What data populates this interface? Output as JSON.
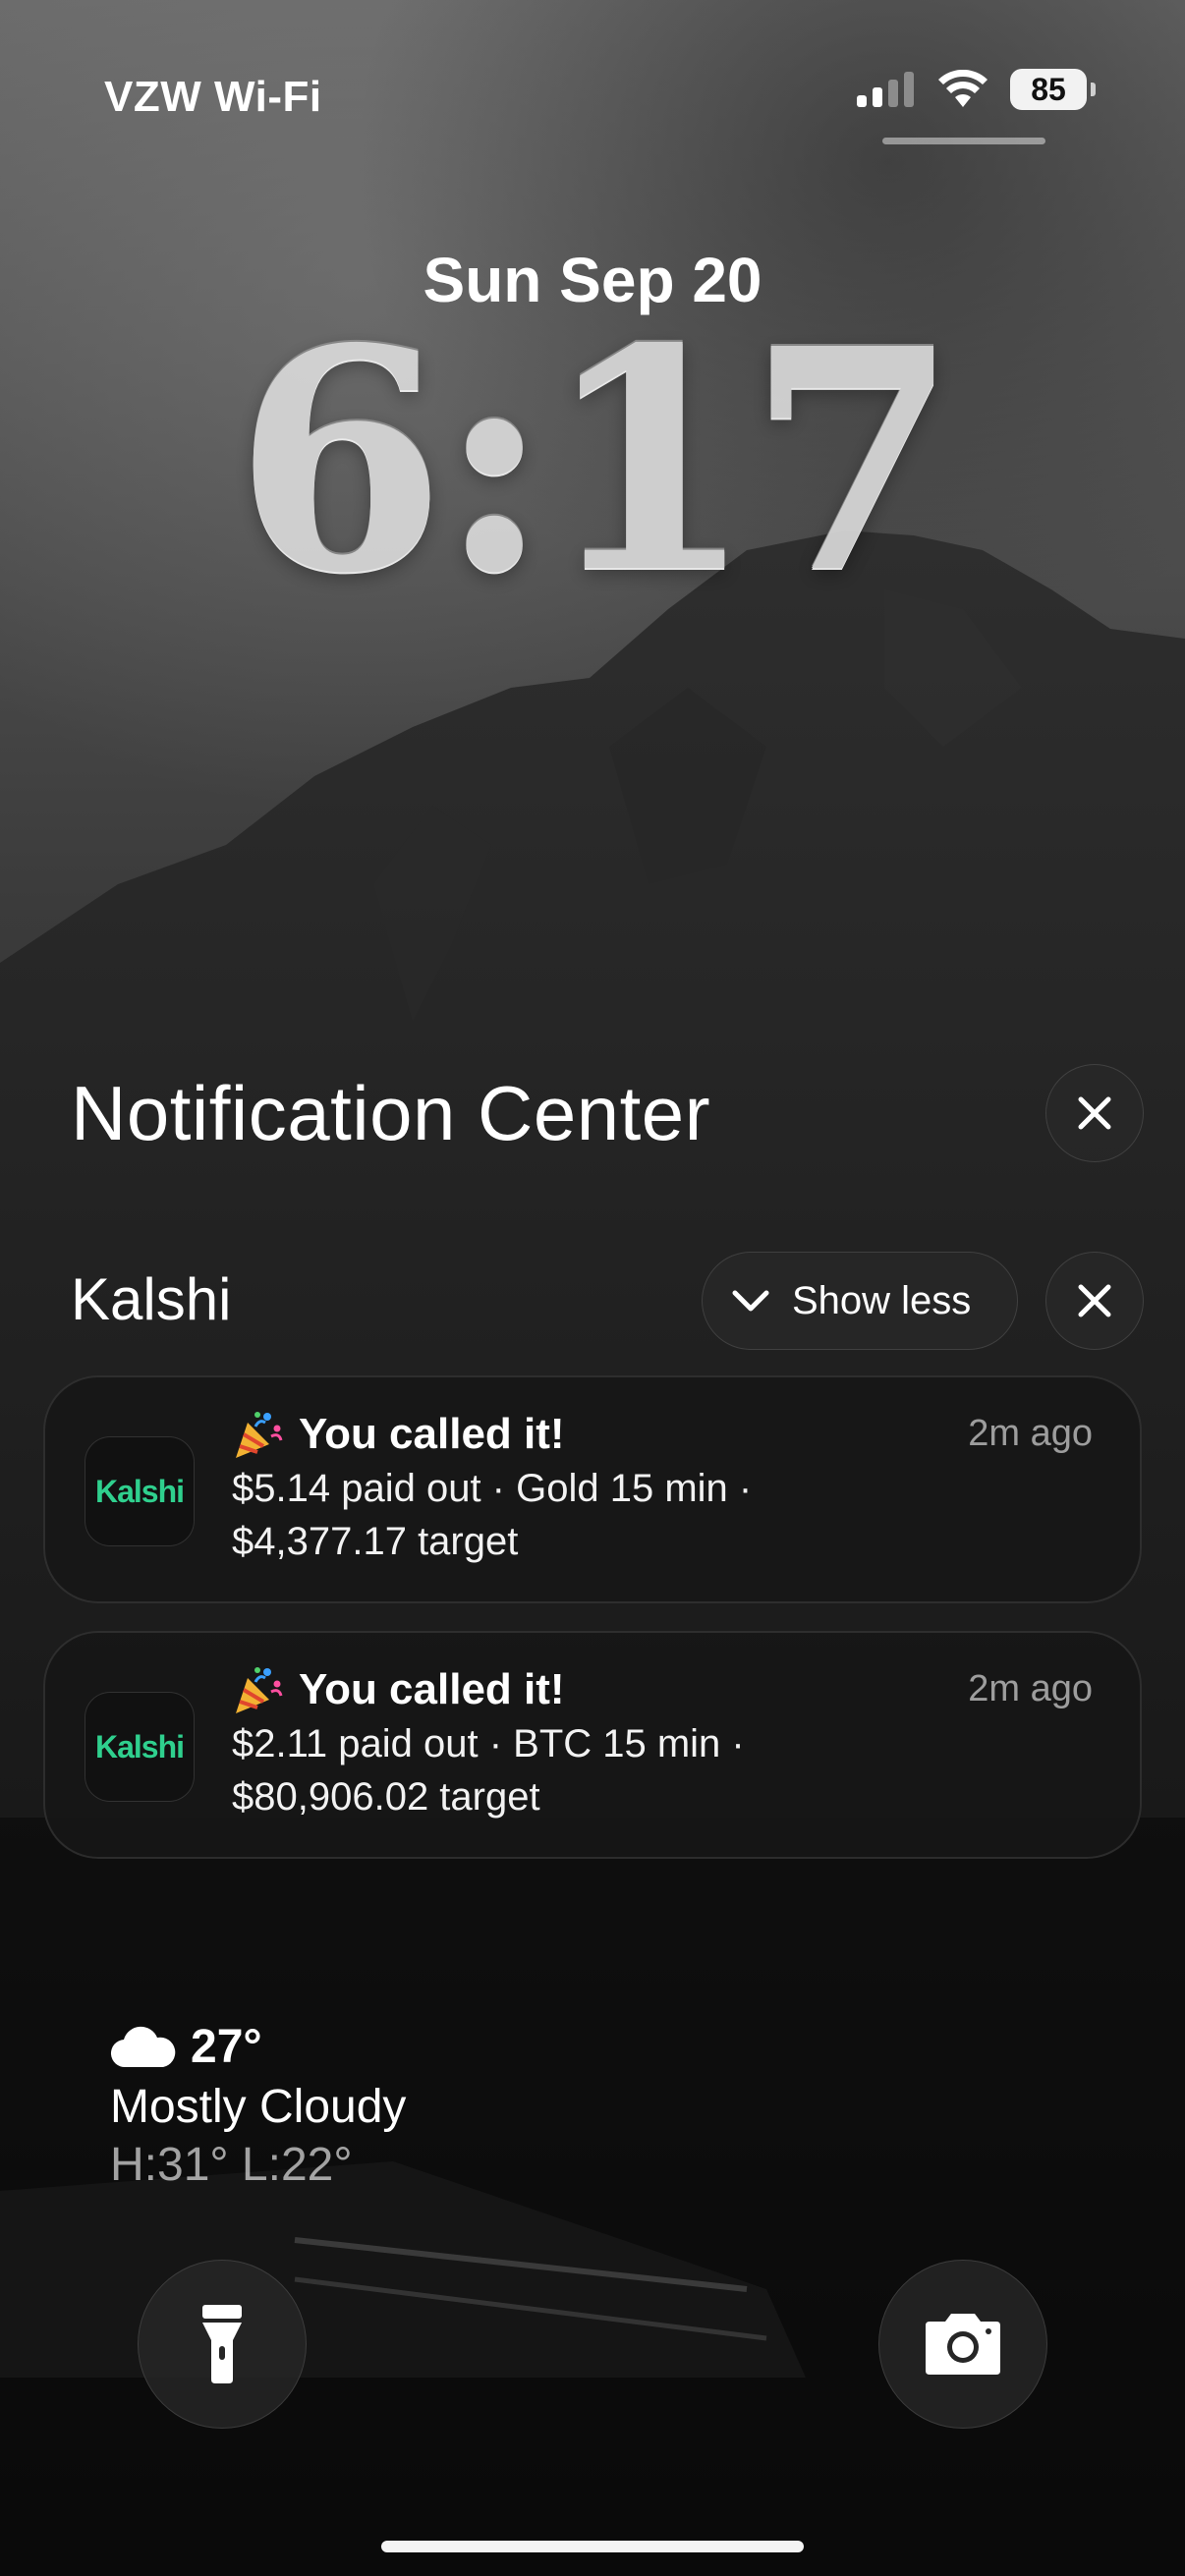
{
  "status_bar": {
    "carrier": "VZW Wi-Fi",
    "battery": "85",
    "signal_icon": "cellular-signal-icon",
    "wifi_icon": "wifi-icon"
  },
  "lock_screen": {
    "date": "Sun Sep 20",
    "time": "6:17"
  },
  "notification_center": {
    "title": "Notification Center",
    "close_icon": "close-icon",
    "group": {
      "app_name": "Kalshi",
      "show_less_label": "Show less",
      "notifications": [
        {
          "app_icon_text": "Kalshi",
          "emoji_icon": "party-popper-icon",
          "title": "You called it!",
          "time": "2m ago",
          "body_line1": "$5.14 paid out · Gold 15 min ·",
          "body_line2": "$4,377.17 target"
        },
        {
          "app_icon_text": "Kalshi",
          "emoji_icon": "party-popper-icon",
          "title": "You called it!",
          "time": "2m ago",
          "body_line1": "$2.11 paid out · BTC 15 min ·",
          "body_line2": "$80,906.02 target"
        }
      ]
    }
  },
  "weather": {
    "icon": "cloud-icon",
    "temperature": "27°",
    "condition": "Mostly Cloudy",
    "high_low": "H:31° L:22°"
  },
  "controls": {
    "flashlight_icon": "flashlight-icon",
    "camera_icon": "camera-icon"
  },
  "colors": {
    "kalshi_brand": "#2fd08e",
    "card_background": "#161616"
  }
}
